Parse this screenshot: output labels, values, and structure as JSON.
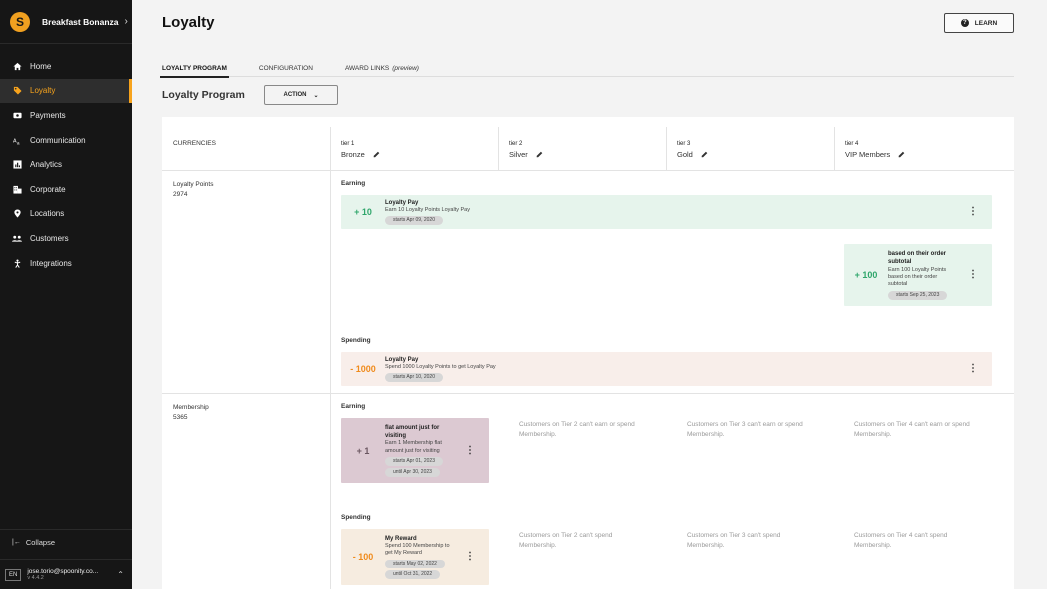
{
  "sidebar": {
    "brand": "Breakfast Bonanza",
    "items": [
      {
        "label": "Home",
        "icon": "home-icon"
      },
      {
        "label": "Loyalty",
        "icon": "tag-icon",
        "active": true
      },
      {
        "label": "Payments",
        "icon": "payments-icon"
      },
      {
        "label": "Communication",
        "icon": "communication-icon"
      },
      {
        "label": "Analytics",
        "icon": "analytics-icon"
      },
      {
        "label": "Corporate",
        "icon": "corporate-icon"
      },
      {
        "label": "Locations",
        "icon": "location-pin-icon"
      },
      {
        "label": "Customers",
        "icon": "customers-icon"
      },
      {
        "label": "Integrations",
        "icon": "integrations-icon"
      }
    ],
    "collapse_label": "Collapse",
    "lang": "EN",
    "user_email": "jose.torio@spoonity.co...",
    "version": "v 4.4.2"
  },
  "header": {
    "title": "Loyalty",
    "learn_label": "LEARN"
  },
  "tabs": [
    {
      "label": "LOYALTY PROGRAM",
      "active": true
    },
    {
      "label": "CONFIGURATION"
    },
    {
      "label": "AWARD LINKS",
      "suffix": "(preview)"
    }
  ],
  "section": {
    "title": "Loyalty Program",
    "action_label": "ACTION"
  },
  "table": {
    "currencies_header": "CURRENCIES",
    "tiers": [
      {
        "num": "tier 1",
        "name": "Bronze"
      },
      {
        "num": "tier 2",
        "name": "Silver"
      },
      {
        "num": "tier 3",
        "name": "Gold"
      },
      {
        "num": "tier 4",
        "name": "VIP Members"
      }
    ],
    "earning_label": "Earning",
    "spending_label": "Spending",
    "loyalty_points": {
      "name": "Loyalty Points",
      "value": "2974",
      "earn_rule_1": {
        "amount": "+ 10",
        "title": "Loyalty Pay",
        "desc": "Earn 10 Loyalty Points Loyalty Pay",
        "start": "starts Apr 09, 2020"
      },
      "earn_rule_2": {
        "amount": "+ 100",
        "title": "based on their order subtotal",
        "desc": "Earn 100 Loyalty Points based on their order subtotal",
        "start": "starts Sep 25, 2023"
      },
      "spend_rule": {
        "amount": "- 1000",
        "title": "Loyalty Pay",
        "desc": "Spend 1000 Loyalty Points to get Loyalty Pay",
        "start": "starts Apr 10, 2020"
      }
    },
    "membership": {
      "name": "Membership",
      "value": "5365",
      "earn_rule": {
        "amount": "+ 1",
        "title": "flat amount just for visiting",
        "desc": "Earn 1 Membership flat amount just for visiting",
        "start": "starts Apr 01, 2023",
        "end": "until Apr 30, 2023"
      },
      "earn_na": [
        "Customers on Tier 2 can't earn or spend Membership.",
        "Customers on Tier 3 can't earn or spend Membership.",
        "Customers on Tier 4 can't earn or spend Membership."
      ],
      "spend_rule": {
        "amount": "- 100",
        "title": "My Reward",
        "desc": "Spend 100 Membership to get My Reward",
        "start": "starts May 02, 2022",
        "end": "until Oct 31, 2022"
      },
      "spend_na": [
        "Customers on Tier 2 can't spend Membership.",
        "Customers on Tier 3 can't spend Membership.",
        "Customers on Tier 4 can't spend Membership."
      ]
    }
  },
  "colors": {
    "accent": "#f7a31c",
    "earn_bg": "#e6f4ec",
    "spend_bg": "#f8eeea",
    "earn_amount": "#2fa66b",
    "spend_amount": "#f08b1c"
  }
}
